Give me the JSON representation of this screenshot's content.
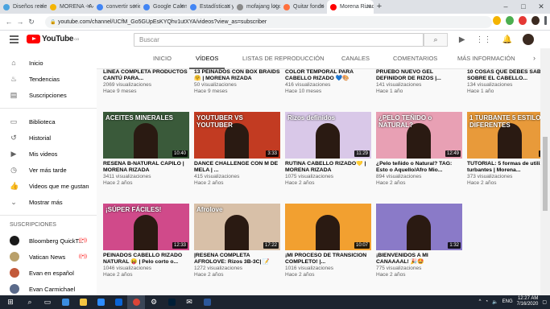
{
  "browser": {
    "tabs": [
      {
        "label": "Diseños recie",
        "color": "#4aa3df"
      },
      {
        "label": "MORENA - A4",
        "color": "#f4b400"
      },
      {
        "label": "convertir serie",
        "color": "#4285f4"
      },
      {
        "label": "Google Calen",
        "color": "#4285f4"
      },
      {
        "label": "Estadísticas y",
        "color": "#4285f4"
      },
      {
        "label": "mofajang logo",
        "color": "#8a8a8a"
      },
      {
        "label": "Quitar fondo",
        "color": "#ff6f3c"
      },
      {
        "label": "Morena Rizad",
        "color": "#ff0000"
      }
    ],
    "new_tab": "+",
    "url": "youtube.com/channel/UCfM_Go5GUpEsKYQhv1utXYA/videos?view_as=subscriber"
  },
  "youtube": {
    "logo": "YouTube",
    "country": "CO",
    "search_placeholder": "Buscar",
    "sidebar": [
      {
        "label": "Inicio",
        "icon": "home-icon",
        "glyph": "⌂"
      },
      {
        "label": "Tendencias",
        "icon": "flame-icon",
        "glyph": "♨"
      },
      {
        "label": "Suscripciones",
        "icon": "subscriptions-icon",
        "glyph": "▤"
      }
    ],
    "sidebar2": [
      {
        "label": "Biblioteca",
        "icon": "library-icon",
        "glyph": "▭"
      },
      {
        "label": "Historial",
        "icon": "history-icon",
        "glyph": "↺"
      },
      {
        "label": "Mis videos",
        "icon": "my-videos-icon",
        "glyph": "▶"
      },
      {
        "label": "Ver más tarde",
        "icon": "watch-later-icon",
        "glyph": "◷"
      },
      {
        "label": "Videos que me gustan",
        "icon": "like-icon",
        "glyph": "👍"
      },
      {
        "label": "Mostrar más",
        "icon": "chevron-down-icon",
        "glyph": "⌄"
      }
    ],
    "subs_header": "SUSCRIPCIONES",
    "subscriptions": [
      {
        "label": "Bloomberg QuickT...",
        "color": "#1a1a1a",
        "live": true
      },
      {
        "label": "Vatican News",
        "color": "#b9a06a",
        "live": true
      },
      {
        "label": "Evan en español",
        "color": "#c2593a",
        "live": false
      },
      {
        "label": "Evan Carmichael",
        "color": "#5a6a8a",
        "live": false
      }
    ],
    "channel_tabs": [
      "INICIO",
      "VÍDEOS",
      "LISTAS DE REPRODUCCIÓN",
      "CANALES",
      "COMENTARIOS",
      "MÁS INFORMACIÓN"
    ],
    "row0": [
      {
        "title": "LÍNEA COMPLETA PRODUCTOS CANTÚ PARA...",
        "views": "2069 visualizaciones",
        "age": "Hace 9 meses"
      },
      {
        "title": "13 PEINADOS CON BOX BRAIDS🤗 | MORENA RIZADA",
        "views": "50 visualizaciones",
        "age": "Hace 9 meses"
      },
      {
        "title": "COLOR TEMPORAL PARA CABELLO RIZADO 💙🎨",
        "views": "416 visualizaciones",
        "age": "Hace 10 meses"
      },
      {
        "title": "PRUEBO NUEVO GEL DEFINIDOR DE RIZOS |...",
        "views": "141 visualizaciones",
        "age": "Hace 1 año"
      },
      {
        "title": "10 COSAS QUE DEBES SABER SOBRE EL CABELLO...",
        "views": "134 visualizaciones",
        "age": "Hace 1 año"
      }
    ],
    "row1": [
      {
        "title": "RESEÑA B-NATURAL CAPILO | MORENA RIZADA",
        "views": "3411 visualizaciones",
        "age": "Hace 2 años",
        "duration": "10:40",
        "overlay": "ACEITES MINERALES",
        "bg": "#3a5a3a"
      },
      {
        "title": "DANCE CHALLENGE CON M DE MELA | ...",
        "views": "415 visualizaciones",
        "age": "Hace 2 años",
        "duration": "3:33",
        "overlay": "YOUTUBER VS YOUTUBER",
        "bg": "#c23b22"
      },
      {
        "title": "RUTINA CABELLO RIZADO💛 | MORENA RIZADA",
        "views": "1075 visualizaciones",
        "age": "Hace 2 años",
        "duration": "11:29",
        "overlay": "Rizos definidos",
        "bg": "#d9c8e8"
      },
      {
        "title": "¿Pelo teñido o Natural? TAG: Esto o Aquello/Afro Mio...",
        "views": "894 visualizaciones",
        "age": "Hace 2 años",
        "duration": "12:49",
        "overlay": "¿PELO TEÑIDO o NATURAL?",
        "bg": "#e8a0b4"
      },
      {
        "title": "TUTORIAL: 5 formas de utilizar turbantes | Morena...",
        "views": "373 visualizaciones",
        "age": "Hace 2 años",
        "duration": "5:49",
        "overlay": "1 TURBANTE 5 ESTILOS DIFERENTES",
        "bg": "#e89a3a"
      }
    ],
    "row2": [
      {
        "title": "PEINADOS CABELLO RIZADO NATURAL 😝 | Pelo corto o...",
        "views": "1046 visualizaciones",
        "age": "Hace 2 años",
        "duration": "12:33",
        "overlay": "¡SÚPER FÁCILES!",
        "bg": "#d04a8a"
      },
      {
        "title": "|RESEÑA COMPLETA AFROLOVE: Rizos 3B-3C| 📝",
        "views": "1272 visualizaciones",
        "age": "Hace 2 años",
        "duration": "17:22",
        "overlay": "Afrolove",
        "bg": "#d8c0a8"
      },
      {
        "title": "¡MI PROCESO DE TRANSICIÓN COMPLETO! |...",
        "views": "1016 visualizaciones",
        "age": "Hace 2 años",
        "duration": "10:07",
        "overlay": "",
        "bg": "#f2a030"
      },
      {
        "title": "¡BIENVENIDOS A MI CANAAAAL! 🎉🤩",
        "views": "775 visualizaciones",
        "age": "Hace 2 años",
        "duration": "1:32",
        "overlay": "",
        "bg": "#8a7ac8"
      }
    ]
  },
  "taskbar": {
    "lang": "ENG",
    "time": "12:27 AM",
    "date": "7/16/2020"
  }
}
